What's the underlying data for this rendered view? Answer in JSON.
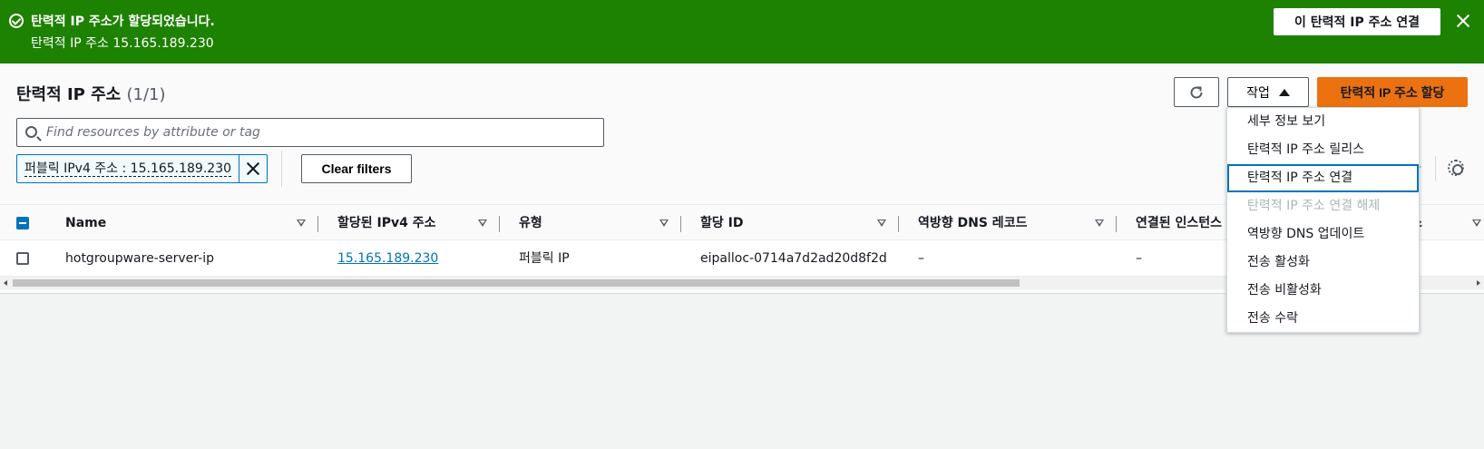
{
  "flash": {
    "title": "탄력적 IP 주소가 할당되었습니다.",
    "message": "탄력적 IP 주소 15.165.189.230",
    "action_label": "이 탄력적 IP 주소 연결",
    "color": "#1d8102"
  },
  "header": {
    "title": "탄력적 IP 주소",
    "count": "(1/1)",
    "actions_label": "작업",
    "allocate_label": "탄력적 IP 주소 할당"
  },
  "filter": {
    "search_placeholder": "Find resources by attribute or tag",
    "token_label": "퍼블릭 IPv4 주소 : 15.165.189.230",
    "clear_label": "Clear filters"
  },
  "table": {
    "columns": [
      "Name",
      "할당된 IPv4 주소",
      "유형",
      "할당 ID",
      "역방향 DNS 레코드",
      "연결된 인스턴스",
      "소"
    ],
    "rows": [
      {
        "name": "hotgroupware-server-ip",
        "ipv4": "15.165.189.230",
        "type": "퍼블릭 IP",
        "allocation_id": "eipalloc-0714a7d2ad20d8f2d",
        "reverse_dns": "–",
        "instance": "–"
      }
    ]
  },
  "menu": {
    "items": [
      {
        "label": "세부 정보 보기",
        "state": "normal"
      },
      {
        "label": "탄력적 IP 주소 릴리스",
        "state": "normal"
      },
      {
        "label": "탄력적 IP 주소 연결",
        "state": "highlighted"
      },
      {
        "label": "탄력적 IP 주소 연결 해제",
        "state": "disabled"
      },
      {
        "label": "역방향 DNS 업데이트",
        "state": "normal"
      },
      {
        "label": "전송 활성화",
        "state": "normal"
      },
      {
        "label": "전송 비활성화",
        "state": "normal"
      },
      {
        "label": "전송 수락",
        "state": "normal"
      }
    ]
  },
  "icons": {
    "flash_status": "check-circle-icon",
    "flash_close": "close-icon",
    "refresh": "refresh-icon",
    "actions_caret": "caret-up-icon",
    "search": "search-icon",
    "token_remove": "close-icon",
    "settings": "gear-icon"
  },
  "colors": {
    "primary_button": "#ec7211",
    "link": "#0073bb",
    "selected_border": "#0073bb"
  }
}
